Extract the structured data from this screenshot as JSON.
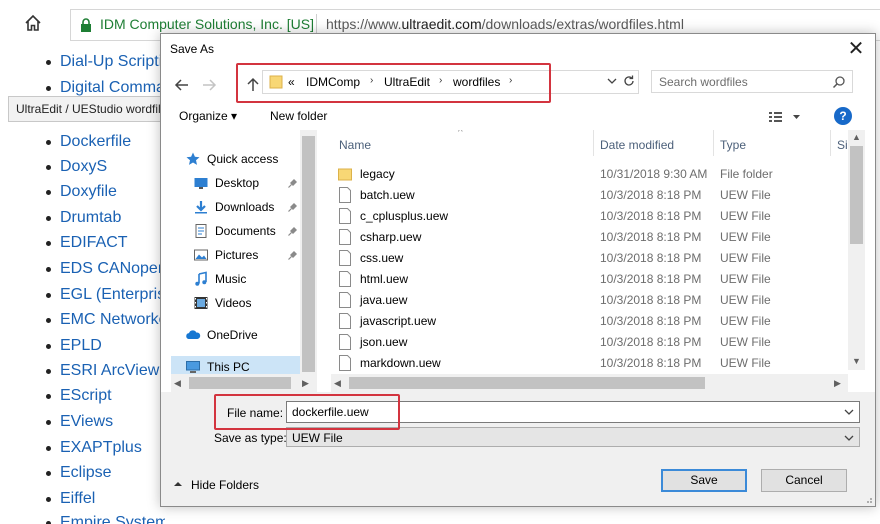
{
  "browser": {
    "site_identity": "IDM Computer Solutions, Inc. [US]",
    "url_prefix": "https://www.",
    "url_host": "ultraedit.com",
    "url_path": "/downloads/extras/wordfiles.html"
  },
  "page": {
    "tooltip": "UltraEdit / UEStudio wordfile",
    "items": [
      "Dial-Up Scripting",
      "Digital Command",
      "Dockerfile",
      "DoxyS",
      "Doxyfile",
      "Drumtab",
      "EDIFACT",
      "EDS CANopen",
      "EGL (Enterprise",
      "EMC Networker",
      "EPLD",
      "ESRI ArcView",
      "EScript",
      "EViews",
      "EXAPTplus",
      "Eclipse",
      "Eiffel",
      "Empire SystemEDGE"
    ]
  },
  "dialog": {
    "title": "Save As",
    "breadcrumb": {
      "prefix": "«",
      "crumbs": [
        "IDMComp",
        "UltraEdit",
        "wordfiles"
      ]
    },
    "search_placeholder": "Search wordfiles",
    "toolbar": {
      "organize": "Organize ▾",
      "new_folder": "New folder"
    },
    "nav": [
      {
        "label": "Quick access",
        "icon": "star-icon",
        "pinned": false
      },
      {
        "label": "Desktop",
        "icon": "desktop-icon",
        "pinned": true
      },
      {
        "label": "Downloads",
        "icon": "downloads-icon",
        "pinned": true
      },
      {
        "label": "Documents",
        "icon": "documents-icon",
        "pinned": true
      },
      {
        "label": "Pictures",
        "icon": "pictures-icon",
        "pinned": true
      },
      {
        "label": "Music",
        "icon": "music-icon",
        "pinned": false
      },
      {
        "label": "Videos",
        "icon": "videos-icon",
        "pinned": false
      },
      {
        "label": "OneDrive",
        "icon": "onedrive-icon",
        "pinned": false
      },
      {
        "label": "This PC",
        "icon": "computer-icon",
        "pinned": false,
        "selected": true
      }
    ],
    "columns": {
      "name": "Name",
      "date": "Date modified",
      "type": "Type",
      "size": "Si"
    },
    "files": [
      {
        "name": "legacy",
        "date": "10/31/2018 9:30 AM",
        "type": "File folder",
        "kind": "folder"
      },
      {
        "name": "batch.uew",
        "date": "10/3/2018 8:18 PM",
        "type": "UEW File",
        "kind": "file"
      },
      {
        "name": "c_cplusplus.uew",
        "date": "10/3/2018 8:18 PM",
        "type": "UEW File",
        "kind": "file"
      },
      {
        "name": "csharp.uew",
        "date": "10/3/2018 8:18 PM",
        "type": "UEW File",
        "kind": "file"
      },
      {
        "name": "css.uew",
        "date": "10/3/2018 8:18 PM",
        "type": "UEW File",
        "kind": "file"
      },
      {
        "name": "html.uew",
        "date": "10/3/2018 8:18 PM",
        "type": "UEW File",
        "kind": "file"
      },
      {
        "name": "java.uew",
        "date": "10/3/2018 8:18 PM",
        "type": "UEW File",
        "kind": "file"
      },
      {
        "name": "javascript.uew",
        "date": "10/3/2018 8:18 PM",
        "type": "UEW File",
        "kind": "file"
      },
      {
        "name": "json.uew",
        "date": "10/3/2018 8:18 PM",
        "type": "UEW File",
        "kind": "file"
      },
      {
        "name": "markdown.uew",
        "date": "10/3/2018 8:18 PM",
        "type": "UEW File",
        "kind": "file"
      }
    ],
    "file_name_label": "File name:",
    "file_name_value": "dockerfile.uew",
    "save_type_label": "Save as type:",
    "save_type_value": "UEW File",
    "hide_folders": "Hide Folders",
    "save_button": "Save",
    "cancel_button": "Cancel"
  },
  "colors": {
    "link": "#1a61b3",
    "highlight": "#d3343f",
    "selection": "#cce4f7",
    "accent": "#3b8ad8"
  }
}
